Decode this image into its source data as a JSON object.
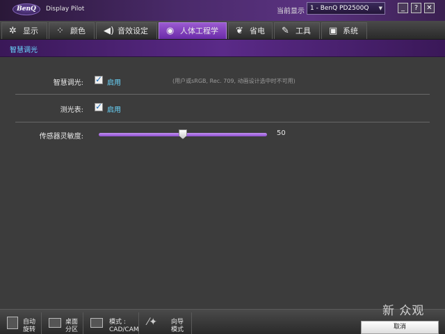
{
  "titlebar": {
    "logo": "BenQ",
    "app_name": "Display Pilot",
    "current_display_label": "当前显示",
    "monitor_value": "1 - BenQ PD2500Q",
    "minimize": "_",
    "help": "?",
    "close": "✕"
  },
  "nav": {
    "tabs": [
      {
        "label": "显示",
        "icon": "sparkle-icon"
      },
      {
        "label": "颜色",
        "icon": "dots-icon"
      },
      {
        "label": "音效设定",
        "icon": "speaker-icon"
      },
      {
        "label": "人体工程学",
        "icon": "eye-icon"
      },
      {
        "label": "省电",
        "icon": "leaf-icon"
      },
      {
        "label": "工具",
        "icon": "wrench-icon"
      },
      {
        "label": "系统",
        "icon": "system-icon"
      }
    ],
    "active": "人体工程学"
  },
  "subheader": {
    "title": "智慧调光"
  },
  "settings": {
    "smart_dim": {
      "label": "智慧调光:",
      "checked": true,
      "enable_text": "启用",
      "note": "(用户或sRGB, Rec. 709, 动画设计选中时不可用)"
    },
    "light_meter": {
      "label": "测光表:",
      "checked": true,
      "enable_text": "启用"
    },
    "sensitivity": {
      "label": "传感器灵敏度:",
      "value": "50",
      "min": 0,
      "max": 100
    }
  },
  "bottombar": {
    "auto_rotate": {
      "line1": "自动",
      "line2": "旋转"
    },
    "desktop_partition": {
      "line1": "桌面",
      "line2": "分区"
    },
    "mode": {
      "line1": "模式 :",
      "line2": "CAD/CAM"
    },
    "wizard": {
      "line1": "向导",
      "line2": "模式"
    },
    "cancel": "取消"
  },
  "watermark": "新 众观",
  "colors": {
    "accent": "#8a4ad0",
    "link": "#6ad8ff"
  }
}
